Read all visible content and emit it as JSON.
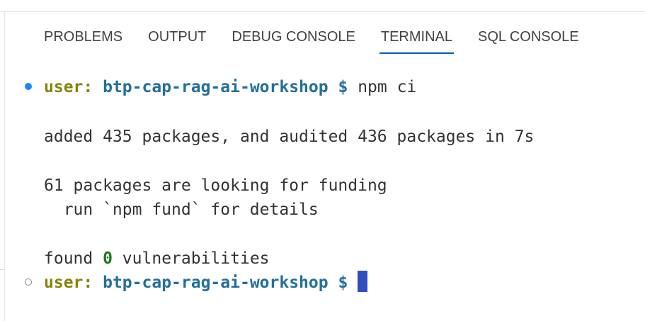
{
  "panel": {
    "tabs": [
      {
        "label": "PROBLEMS",
        "active": false
      },
      {
        "label": "OUTPUT",
        "active": false
      },
      {
        "label": "DEBUG CONSOLE",
        "active": false
      },
      {
        "label": "TERMINAL",
        "active": true
      },
      {
        "label": "SQL CONSOLE",
        "active": false
      }
    ]
  },
  "terminal": {
    "prompt1": {
      "user": "user:",
      "dir": "btp-cap-rag-ai-workshop",
      "symbol": "$",
      "command": "npm ci"
    },
    "output": {
      "added": "added 435 packages, and audited 436 packages in 7s",
      "funding": "61 packages are looking for funding",
      "fund_hint": "  run `npm fund` for details",
      "found_prefix": "found ",
      "found_count": "0",
      "found_suffix": " vulnerabilities"
    },
    "prompt2": {
      "user": "user:",
      "dir": "btp-cap-rag-ai-workshop",
      "symbol": "$"
    }
  },
  "colors": {
    "active_tab_underline": "#005fb8",
    "prompt_user": "#868409",
    "prompt_dir": "#236f9b",
    "success_number": "#1b7a19",
    "cursor": "#2f4fc0",
    "decoration_success": "#1a85ff"
  }
}
